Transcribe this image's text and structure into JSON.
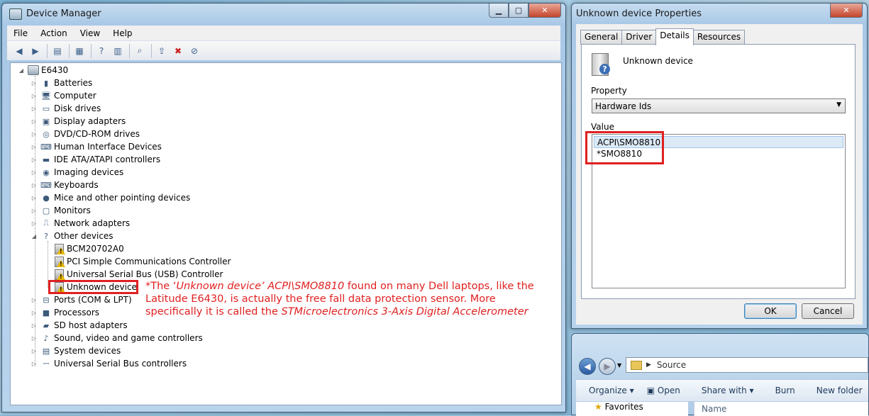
{
  "device_manager": {
    "title": "Device Manager",
    "menu": [
      "File",
      "Action",
      "View",
      "Help"
    ],
    "root": "E6430",
    "categories": [
      {
        "label": "Batteries",
        "icon": "battery-icon"
      },
      {
        "label": "Computer",
        "icon": "computer-icon"
      },
      {
        "label": "Disk drives",
        "icon": "disk-drive-icon"
      },
      {
        "label": "Display adapters",
        "icon": "display-adapter-icon"
      },
      {
        "label": "DVD/CD-ROM drives",
        "icon": "dvd-icon"
      },
      {
        "label": "Human Interface Devices",
        "icon": "hid-icon"
      },
      {
        "label": "IDE ATA/ATAPI controllers",
        "icon": "ide-icon"
      },
      {
        "label": "Imaging devices",
        "icon": "camera-icon"
      },
      {
        "label": "Keyboards",
        "icon": "keyboard-icon"
      },
      {
        "label": "Mice and other pointing devices",
        "icon": "mouse-icon"
      },
      {
        "label": "Monitors",
        "icon": "monitor-icon"
      },
      {
        "label": "Network adapters",
        "icon": "network-icon"
      },
      {
        "label": "Other devices",
        "icon": "other-devices-icon"
      }
    ],
    "other_devices": [
      "BCM20702A0",
      "PCI Simple Communications Controller",
      "Universal Serial Bus (USB) Controller",
      "Unknown device"
    ],
    "categories_after": [
      {
        "label": "Ports (COM & LPT)",
        "icon": "port-icon"
      },
      {
        "label": "Processors",
        "icon": "processor-icon"
      },
      {
        "label": "SD host adapters",
        "icon": "sd-card-icon"
      },
      {
        "label": "Sound, video and game controllers",
        "icon": "sound-icon"
      },
      {
        "label": "System devices",
        "icon": "system-device-icon"
      },
      {
        "label": "Universal Serial Bus controllers",
        "icon": "usb-icon"
      }
    ]
  },
  "annotation": {
    "prefix": "*The ‘",
    "device_italic": "Unknown device’ ACPI\\SMO8810",
    "middle": " found on many Dell laptops, like the Latitude E6430, is actually the free fall data protection sensor. More specifically it is called the ",
    "sensor_italic": "STMicroelectronics 3-Axis Digital Accelerometer"
  },
  "properties": {
    "title": "Unknown device Properties",
    "tabs": [
      "General",
      "Driver",
      "Details",
      "Resources"
    ],
    "active_tab": "Details",
    "device_name": "Unknown device",
    "property_label": "Property",
    "property_value": "Hardware Ids",
    "value_label": "Value",
    "values": [
      "ACPI\\SMO8810",
      "*SMO8810"
    ],
    "ok": "OK",
    "cancel": "Cancel"
  },
  "explorer": {
    "address": "Source",
    "commands": [
      "Organize",
      "Open",
      "Share with",
      "Burn",
      "New folder"
    ],
    "nav_item": "Favorites",
    "column": "Name"
  },
  "colors": {
    "highlight_red": "#e02020",
    "accent_blue": "#3c7fb1"
  }
}
